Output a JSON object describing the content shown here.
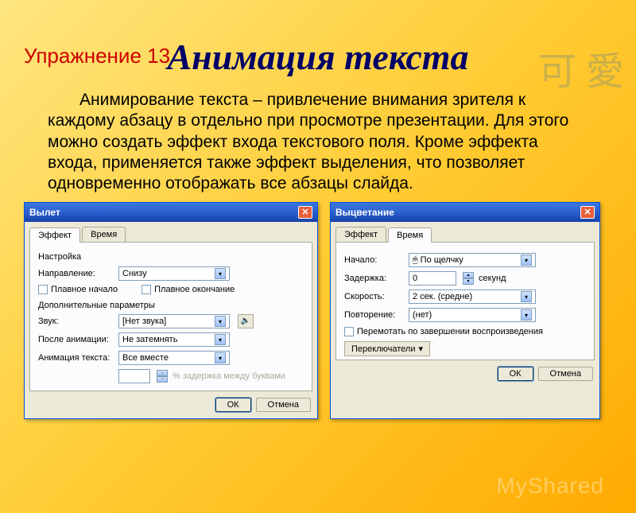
{
  "exercise_label": "Упражнение 13",
  "decor_chars": "可 愛",
  "title": "Анимация текста",
  "body": "Анимирование текста – привлечение внимания зрителя к каждому абзацу в отдельно при просмотре презентации. Для этого можно создать эффект входа текстового поля. Кроме эффекта входа, применяется также эффект выделения, что позволяет одновременно отображать все абзацы слайда.",
  "dlg1": {
    "title": "Вылет",
    "tabs": [
      "Эффект",
      "Время"
    ],
    "active_tab": 0,
    "group1": "Настройка",
    "direction_label": "Направление:",
    "direction_value": "Снизу",
    "smooth_start": "Плавное начало",
    "smooth_end": "Плавное окончание",
    "group2": "Дополнительные параметры",
    "sound_label": "Звук:",
    "sound_value": "[Нет звука]",
    "after_label": "После анимации:",
    "after_value": "Не затемнять",
    "text_label": "Анимация текста:",
    "text_value": "Все вместе",
    "delay_hint": "% задержка между буквами",
    "ok": "ОК",
    "cancel": "Отмена"
  },
  "dlg2": {
    "title": "Выцветание",
    "tabs": [
      "Эффект",
      "Время"
    ],
    "active_tab": 1,
    "start_label": "Начало:",
    "start_value": "По щелчку",
    "start_icon": "🖱",
    "delay_label": "Задержка:",
    "delay_value": "0",
    "delay_unit": "секунд",
    "speed_label": "Скорость:",
    "speed_value": "2 сек. (средне)",
    "repeat_label": "Повторение:",
    "repeat_value": "(нет)",
    "rewind": "Перемотать по завершении воспроизведения",
    "toggles": "Переключатели",
    "ok": "ОК",
    "cancel": "Отмена"
  },
  "watermark": "MyShared"
}
